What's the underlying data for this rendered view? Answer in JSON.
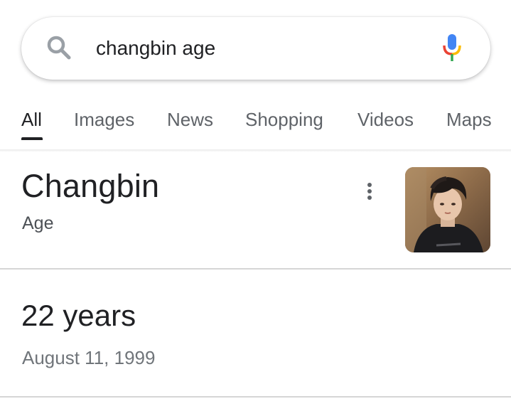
{
  "search": {
    "value": "changbin age",
    "search_icon": "search-icon",
    "mic_icon": "mic-icon",
    "colors": {
      "mic_blue": "#4285F4",
      "mic_red": "#EA4335",
      "mic_yellow": "#FBBC05",
      "mic_green": "#34A853"
    }
  },
  "tabs": [
    {
      "label": "All",
      "active": true
    },
    {
      "label": "Images",
      "active": false
    },
    {
      "label": "News",
      "active": false
    },
    {
      "label": "Shopping",
      "active": false
    },
    {
      "label": "Videos",
      "active": false
    },
    {
      "label": "Maps",
      "active": false
    }
  ],
  "knowledge_panel": {
    "title": "Changbin",
    "subtitle": "Age",
    "more_icon": "more-vert-icon"
  },
  "answer": {
    "value": "22 years",
    "detail": "August 11, 1999"
  }
}
